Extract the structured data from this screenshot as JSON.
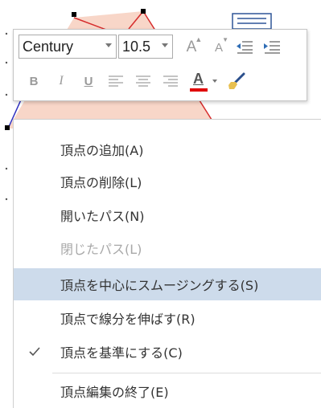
{
  "toolbar": {
    "font_name": "Century",
    "font_size": "10.5",
    "font_color": "#e00000",
    "icons": [
      "grow-font-icon",
      "shrink-font-icon",
      "decrease-indent-icon",
      "increase-indent-icon",
      "bold-icon",
      "italic-icon",
      "underline-icon",
      "align-left-icon",
      "align-center-icon",
      "align-right-icon",
      "font-color-icon",
      "format-painter-icon"
    ],
    "bold_label": "B",
    "italic_label": "I",
    "underline_label": "U",
    "font_color_label": "A",
    "grow_font_label": "A",
    "shrink_font_label": "A"
  },
  "menu": {
    "items": [
      {
        "label": "頂点の追加(A)",
        "state": "normal"
      },
      {
        "label": "頂点の削除(L)",
        "state": "normal"
      },
      {
        "label": "開いたパス(N)",
        "state": "normal"
      },
      {
        "label": "閉じたパス(L)",
        "state": "disabled"
      },
      {
        "label": "頂点を中心にスムージングする(S)",
        "state": "highlighted"
      },
      {
        "label": "頂点で線分を伸ばす(R)",
        "state": "normal"
      },
      {
        "label": "頂点を基準にする(C)",
        "state": "checked"
      },
      {
        "label": "頂点編集の終了(E)",
        "state": "normal"
      }
    ]
  },
  "colors": {
    "highlight": "#cddbeb",
    "shape_fill": "#f8d6c8",
    "shape_outline_red": "#d62c2c",
    "shape_outline_blue": "#3030c0"
  }
}
